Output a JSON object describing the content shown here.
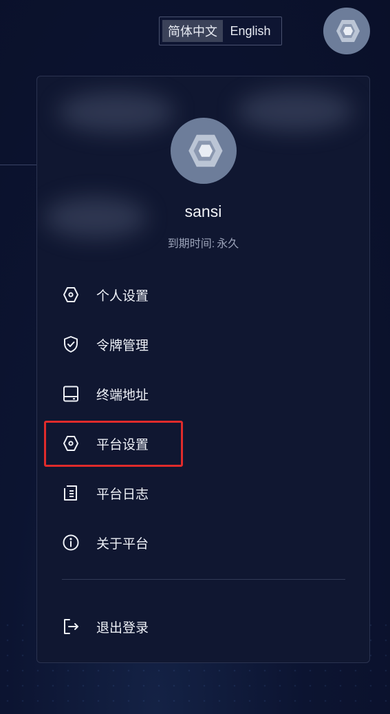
{
  "language": {
    "options": [
      {
        "label": "简体中文",
        "selected": true
      },
      {
        "label": "English",
        "selected": false
      }
    ]
  },
  "user": {
    "name": "sansi",
    "expiry_label": "到期时间:",
    "expiry_value": "永久"
  },
  "menu": {
    "items": [
      {
        "label": "个人设置",
        "icon": "hexagon-settings-icon"
      },
      {
        "label": "令牌管理",
        "icon": "shield-check-icon"
      },
      {
        "label": "终端地址",
        "icon": "terminal-device-icon"
      },
      {
        "label": "平台设置",
        "icon": "hexagon-settings-icon",
        "highlighted": true
      },
      {
        "label": "平台日志",
        "icon": "document-log-icon"
      },
      {
        "label": "关于平台",
        "icon": "info-circle-icon"
      }
    ],
    "logout": {
      "label": "退出登录",
      "icon": "logout-icon"
    }
  },
  "colors": {
    "background": "#0c1431",
    "panel": "#101731",
    "avatar": "#6d7d9a",
    "highlight_border": "#e02b2b"
  }
}
